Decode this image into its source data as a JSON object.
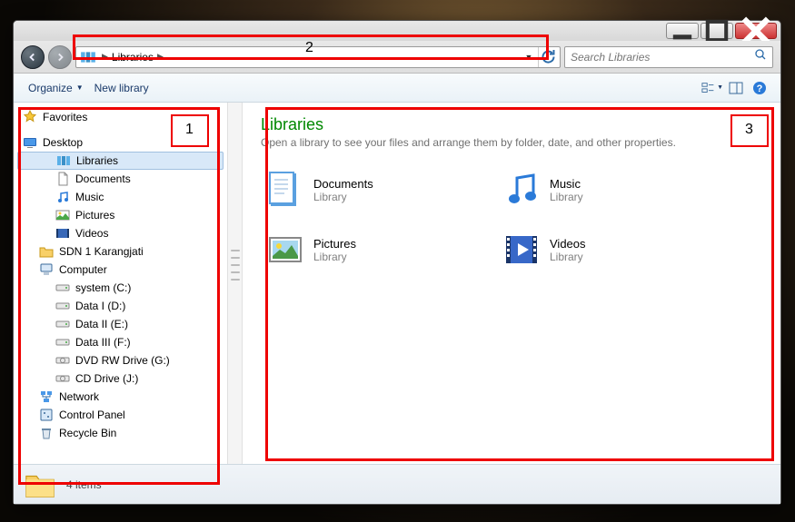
{
  "titlebar": {
    "min": "—",
    "max": "▢",
    "close": "✕"
  },
  "nav": {
    "breadcrumb_root": "Libraries",
    "search_placeholder": "Search Libraries"
  },
  "toolbar": {
    "organize": "Organize",
    "newlibrary": "New library"
  },
  "sidebar": {
    "favorites": "Favorites",
    "desktop": "Desktop",
    "libraries": "Libraries",
    "documents": "Documents",
    "music": "Music",
    "pictures": "Pictures",
    "videos": "Videos",
    "sdn": "SDN 1 Karangjati",
    "computer": "Computer",
    "drive_c": "system (C:)",
    "drive_d": "Data I (D:)",
    "drive_e": "Data II (E:)",
    "drive_f": "Data III (F:)",
    "drive_g": "DVD RW Drive (G:)",
    "drive_j": "CD Drive (J:)",
    "network": "Network",
    "cpanel": "Control Panel",
    "recycle": "Recycle Bin"
  },
  "content": {
    "title": "Libraries",
    "subtitle": "Open a library to see your files and arrange them by folder, date, and other properties.",
    "type_label": "Library",
    "items": [
      {
        "name": "Documents",
        "icon": "doc"
      },
      {
        "name": "Music",
        "icon": "music"
      },
      {
        "name": "Pictures",
        "icon": "pic"
      },
      {
        "name": "Videos",
        "icon": "vid"
      }
    ]
  },
  "status": {
    "text": "4 items"
  },
  "annotations": {
    "a1": "1",
    "a2": "2",
    "a3": "3"
  }
}
